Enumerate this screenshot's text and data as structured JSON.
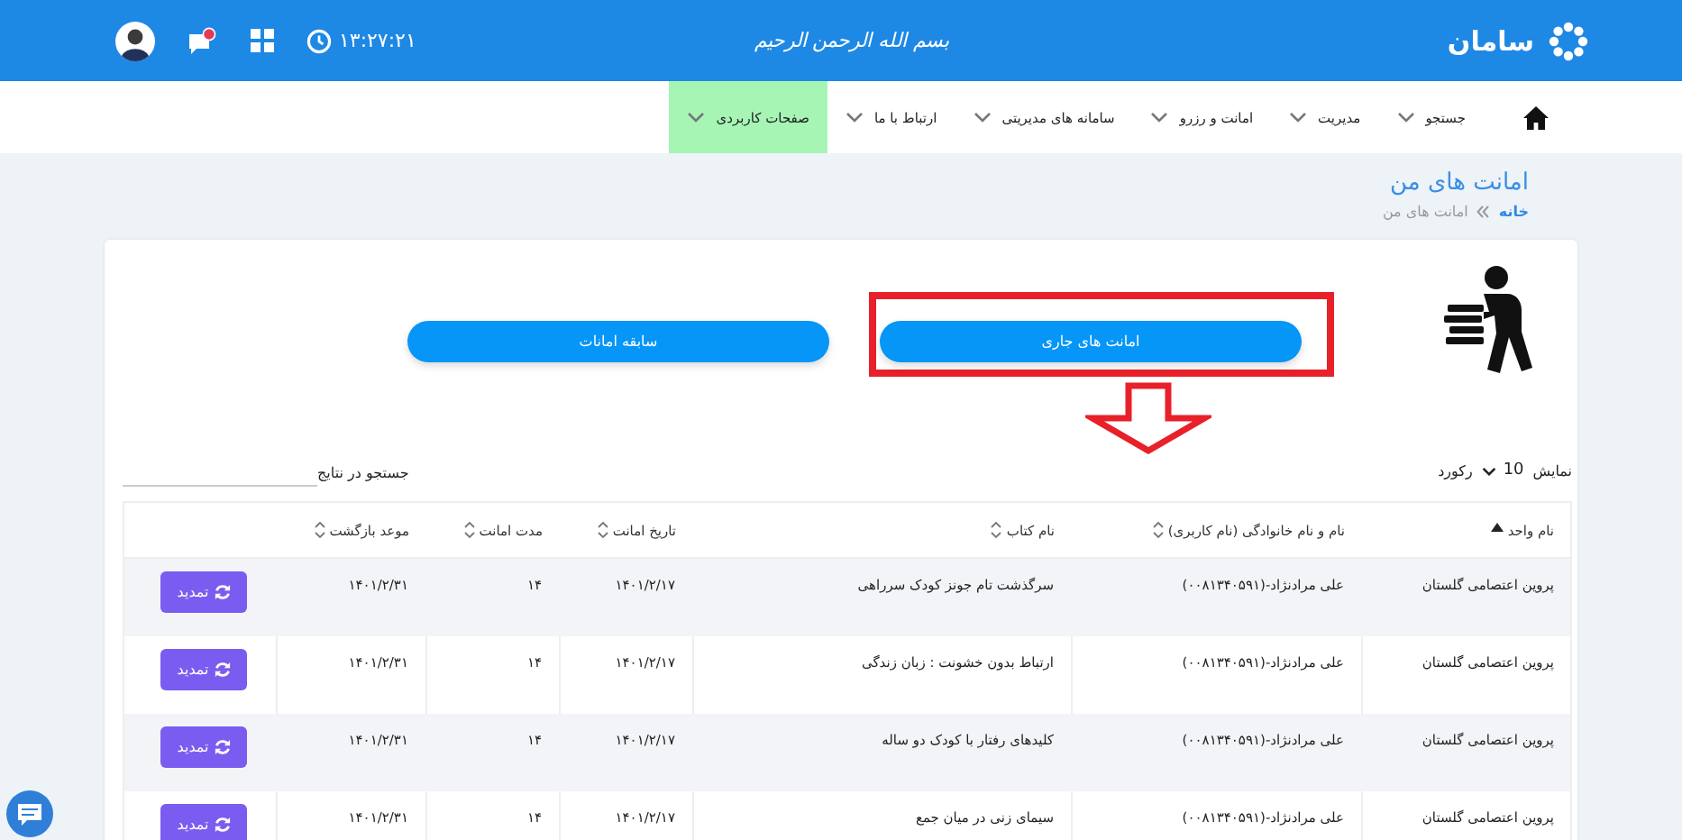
{
  "header": {
    "logo": "سامان",
    "motto": "بسم الله الرحمن الرحیم",
    "time": "۱۳:۲۷:۲۱",
    "notification": true
  },
  "nav": {
    "items": [
      {
        "label": "جستجو",
        "selected": false
      },
      {
        "label": "مدیریت",
        "selected": false
      },
      {
        "label": "امانت و رزرو",
        "selected": false
      },
      {
        "label": "سامانه های مدیریتی",
        "selected": false
      },
      {
        "label": "ارتباط با ما",
        "selected": false
      },
      {
        "label": "صفحات کاربردی",
        "selected": true
      }
    ]
  },
  "page": {
    "title": "امانت های من",
    "breadcrumb": [
      {
        "label": "خانه",
        "link": true
      },
      {
        "label": "امانت های من",
        "link": false
      }
    ]
  },
  "buttons": [
    {
      "label": "امانت های جاری",
      "annotated": true
    },
    {
      "label": "سابقه امانات",
      "annotated": false
    }
  ],
  "length_menu": {
    "prefix": "نمایش",
    "value": "10",
    "suffix": "رکورد"
  },
  "search": {
    "label": "جستجو در نتایج"
  },
  "table": {
    "columns": [
      {
        "label": "نام واحد",
        "sorted": true
      },
      {
        "label": "نام و نام خانوادگی (نام کاربری)",
        "sorted": false
      },
      {
        "label": "نام کتاب",
        "sorted": false
      },
      {
        "label": "تاریخ امانت",
        "sorted": false
      },
      {
        "label": "مدت امانت",
        "sorted": false
      },
      {
        "label": "موعد بازگشت",
        "sorted": false
      }
    ],
    "rows": [
      {
        "cells": [
          "پروین اعتصامی گلستان",
          "علی مرادنژاد-(۰۰۸۱۳۴۰۵۹۱)",
          "سرگذشت تام جونز کودک سرراهی",
          "۱۴۰۱/۲/۱۷",
          "۱۴",
          "۱۴۰۱/۲/۳۱"
        ],
        "action": "تمدید"
      },
      {
        "cells": [
          "پروین اعتصامی گلستان",
          "علی مرادنژاد-(۰۰۸۱۳۴۰۵۹۱)",
          "ارتباط بدون خشونت : زبان زندگی",
          "۱۴۰۱/۲/۱۷",
          "۱۴",
          "۱۴۰۱/۲/۳۱"
        ],
        "action": "تمدید"
      },
      {
        "cells": [
          "پروین اعتصامی گلستان",
          "علی مرادنژاد-(۰۰۸۱۳۴۰۵۹۱)",
          "کلیدهای رفتار با کودک دو ساله",
          "۱۴۰۱/۲/۱۷",
          "۱۴",
          "۱۴۰۱/۲/۳۱"
        ],
        "action": "تمدید"
      },
      {
        "cells": [
          "پروین اعتصامی گلستان",
          "علی مرادنژاد-(۰۰۸۱۳۴۰۵۹۱)",
          "سیمای زنی در میان جمع",
          "۱۴۰۱/۲/۱۷",
          "۱۴",
          "۱۴۰۱/۲/۳۱"
        ],
        "action": "تمدید"
      }
    ]
  }
}
